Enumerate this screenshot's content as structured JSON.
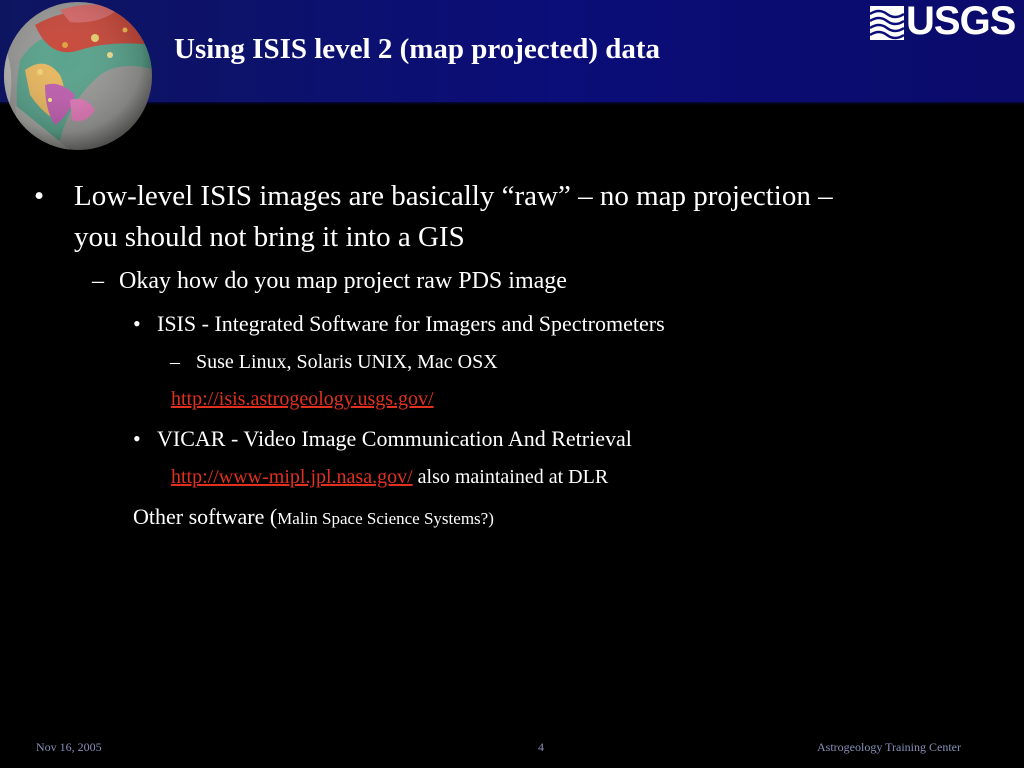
{
  "slide": {
    "title": "Using ISIS level 2 (map projected) data",
    "logo_text": "USGS",
    "bullets": {
      "b1_marker": "•",
      "b1_line1": "Low-level ISIS images are basically “raw” – no map projection –",
      "b1_line2": "you should not bring it into a GIS",
      "b2_marker": "–",
      "b2_text": "Okay how do you map project raw PDS image",
      "b3a_marker": "•",
      "b3a_text": "ISIS - Integrated Software for Imagers and Spectrometers",
      "b4_marker": "–",
      "b4_text": "Suse Linux, Solaris UNIX, Mac OSX",
      "isis_link": "http://isis.astrogeology.usgs.gov/",
      "b3b_marker": "•",
      "b3b_text": "VICAR - Video Image Communication And Retrieval",
      "vicar_link": "http://www-mipl.jpl.nasa.gov/",
      "vicar_note": " also maintained at DLR",
      "other_prefix": "Other software (",
      "other_small": "Malin Space Science Systems?)"
    },
    "footer": {
      "date": "Nov 16, 2005",
      "page": "4",
      "org": "Astrogeology Training Center"
    }
  },
  "icons": {
    "globe": "mars-globe-icon",
    "logo": "usgs-logo"
  },
  "colors": {
    "header": "#0b0d78",
    "background": "#000000",
    "link": "#e03020",
    "footer_text": "#8890b8"
  }
}
